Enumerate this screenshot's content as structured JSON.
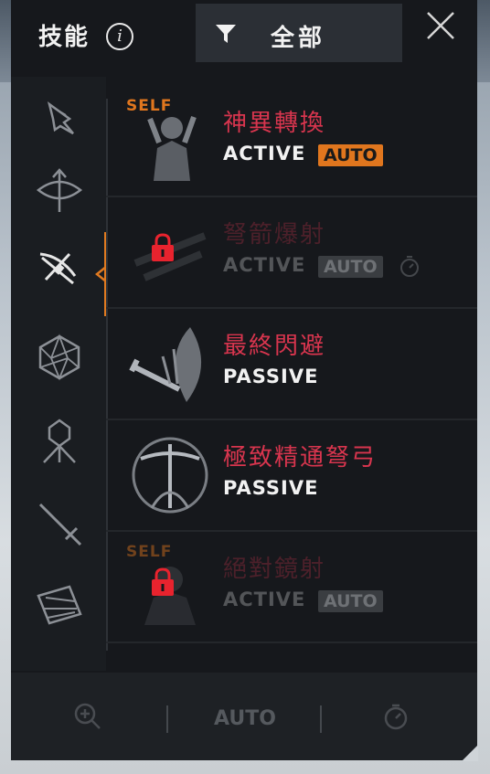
{
  "header": {
    "title": "技能",
    "info_icon": "info-icon",
    "filter_label": "全部",
    "filter_icon": "filter-funnel-icon",
    "close_icon": "close-x-icon"
  },
  "sidebar": {
    "categories": [
      {
        "icon": "bird-skill-icon",
        "selected": false
      },
      {
        "icon": "crossed-bows-icon",
        "selected": false
      },
      {
        "icon": "crossbow-icon",
        "selected": true
      },
      {
        "icon": "polyhedron-icon",
        "selected": false
      },
      {
        "icon": "hooded-figure-icon",
        "selected": false
      },
      {
        "icon": "sword-icon",
        "selected": false
      },
      {
        "icon": "arm-guard-icon",
        "selected": false
      }
    ]
  },
  "skills": [
    {
      "name": "神異轉換",
      "type": "ACTIVE",
      "auto": "AUTO",
      "self": "SELF",
      "locked": false
    },
    {
      "name": "弩箭爆射",
      "type": "ACTIVE",
      "auto": "AUTO",
      "self": "",
      "locked": true
    },
    {
      "name": "最終閃避",
      "type": "PASSIVE",
      "auto": "",
      "self": "",
      "locked": false
    },
    {
      "name": "極致精通弩弓",
      "type": "PASSIVE",
      "auto": "",
      "self": "",
      "locked": false
    },
    {
      "name": "絕對鏡射",
      "type": "ACTIVE",
      "auto": "AUTO",
      "self": "SELF",
      "locked": true
    }
  ],
  "footer": {
    "zoom_icon": "zoom-in-icon",
    "auto_label": "AUTO",
    "timer_icon": "stopwatch-icon"
  },
  "colors": {
    "accent": "#e0761e",
    "skill_name": "#d8354e",
    "lock": "#e8232e",
    "panel": "#16181c"
  }
}
